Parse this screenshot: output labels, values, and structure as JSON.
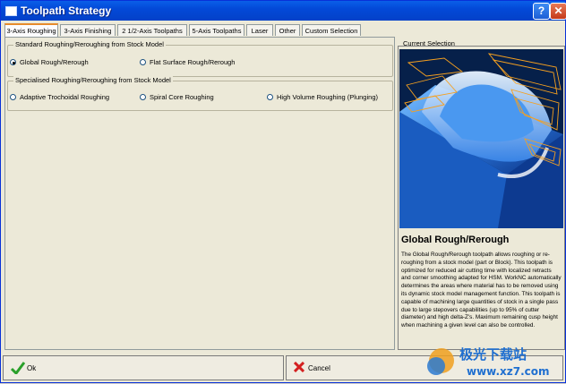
{
  "window": {
    "title": "Toolpath Strategy",
    "help_label": "?",
    "close_label": "✕"
  },
  "tabs": [
    {
      "label": "3-Axis Roughing",
      "active": true
    },
    {
      "label": "3-Axis Finishing"
    },
    {
      "label": "2 1/2-Axis Toolpaths"
    },
    {
      "label": "5-Axis Toolpaths"
    },
    {
      "label": "Laser"
    },
    {
      "label": "Other"
    },
    {
      "label": "Custom Selection"
    }
  ],
  "groups": {
    "standard": {
      "title": "Standard Roughing/Reroughing from Stock Model",
      "options": [
        {
          "label": "Global Rough/Rerough",
          "selected": true
        },
        {
          "label": "Flat Surface Rough/Rerough",
          "selected": false
        }
      ]
    },
    "specialised": {
      "title": "Specialised Roughing/Reroughing from Stock Model",
      "options": [
        {
          "label": "Adaptive Trochoidal Roughing",
          "selected": false
        },
        {
          "label": "Spiral Core Roughing",
          "selected": false
        },
        {
          "label": "High Volume Roughing (Plunging)",
          "selected": false
        }
      ]
    }
  },
  "current_selection": {
    "title": "Current Selection",
    "heading": "Global Rough/Rerough",
    "description": "The Global Rough/Rerough toolpath allows roughing or re-roughing from a stock model (part or Block). This toolpath is optimized for reduced air cutting time with localized retracts and corner smoothing adapted for HSM. WorkNC automatically determines the areas where material has to be removed using its dynamic stock model management function. This toolpath is capable of machining large quantities of stock in a single pass due to large stepovers capabilities (up to 95% of cutter diameter) and high delta-Z's. Maximum remaining cusp height when machining a given level can also be controlled."
  },
  "buttons": {
    "ok": "Ok",
    "cancel": "Cancel"
  },
  "watermark": {
    "line1": "极光下载站",
    "line2": "www.xz7.com"
  },
  "colors": {
    "title_bar": "#0349d8",
    "tab_active_accent": "#e68b2c",
    "ok_check": "#2aa02a",
    "cancel_x": "#d42020",
    "toolpath": "#f5a020",
    "part": "#2c7ae0"
  }
}
